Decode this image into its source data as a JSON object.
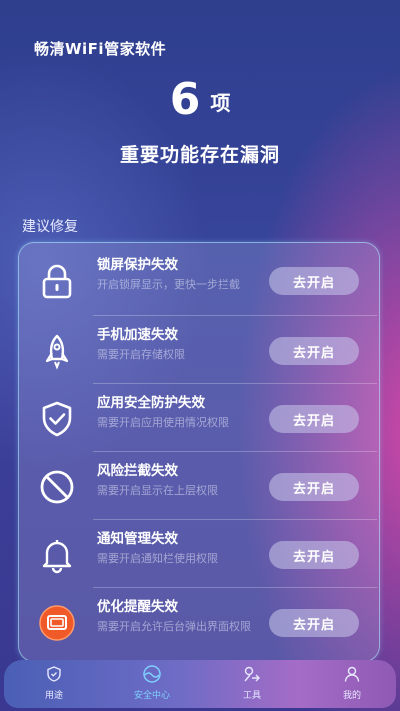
{
  "header": {
    "app_title": "畅清WiFi管家软件",
    "count": "6",
    "count_unit": "项",
    "subtitle": "重要功能存在漏洞"
  },
  "section_title": "建议修复",
  "items": [
    {
      "title": "锁屏保护失效",
      "desc": "开启锁屏显示，更快一步拦截",
      "action": "去开启",
      "icon": "lock-icon"
    },
    {
      "title": "手机加速失效",
      "desc": "需要开启存储权限",
      "action": "去开启",
      "icon": "rocket-icon"
    },
    {
      "title": "应用安全防护失效",
      "desc": "需要开启应用使用情况权限",
      "action": "去开启",
      "icon": "shield-check-icon"
    },
    {
      "title": "风险拦截失效",
      "desc": "需要开启显示在上层权限",
      "action": "去开启",
      "icon": "block-icon"
    },
    {
      "title": "通知管理失效",
      "desc": "需要开启通知栏使用权限",
      "action": "去开启",
      "icon": "bell-icon"
    },
    {
      "title": "优化提醒失效",
      "desc": "需要开启允许后台弹出界面权限",
      "action": "去开启",
      "icon": "window-icon"
    }
  ],
  "tabbar": {
    "tabs": [
      {
        "label": "用途",
        "icon": "shield-icon",
        "active": false
      },
      {
        "label": "安全中心",
        "icon": "wave-icon",
        "active": true
      },
      {
        "label": "工具",
        "icon": "tools-icon",
        "active": false
      },
      {
        "label": "我的",
        "icon": "user-icon",
        "active": false
      }
    ]
  },
  "colors": {
    "background_top": "#2f3f8e",
    "background_accent": "#ec4aaa",
    "active_tab": "#7fd0ff",
    "alert_orange": "#f05a28"
  }
}
